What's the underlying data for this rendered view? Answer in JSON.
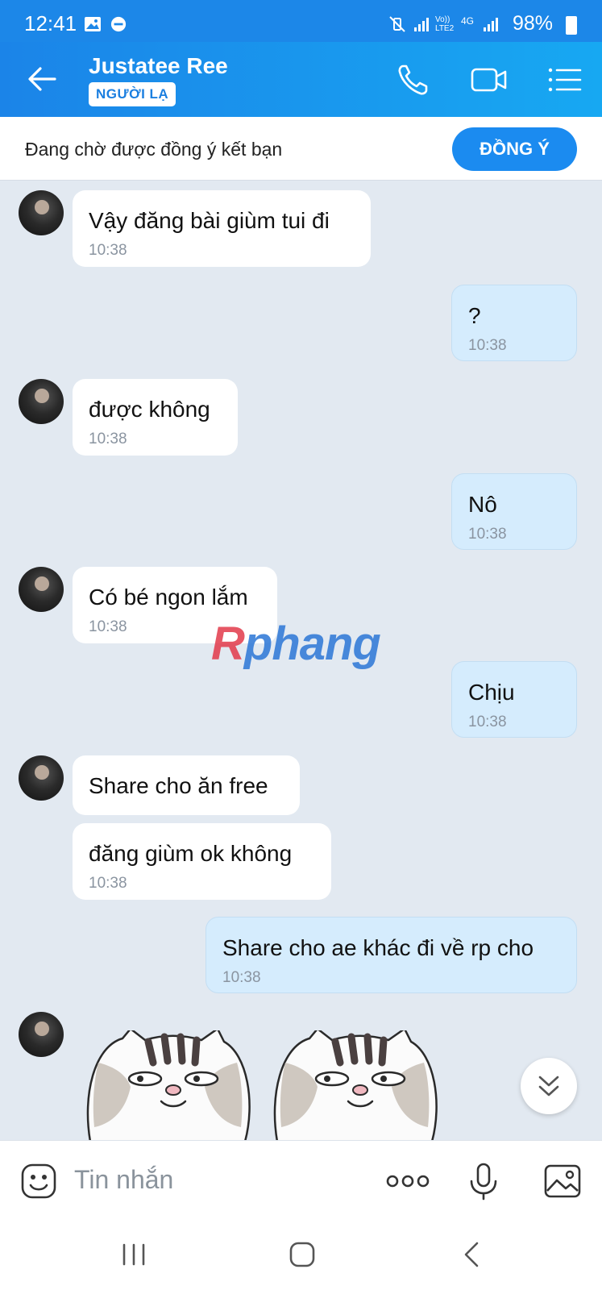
{
  "status_bar": {
    "time": "12:41",
    "network_label_1": "Vo)) LTE2",
    "network_label_2": "4G",
    "battery": "98%"
  },
  "header": {
    "contact_name": "Justatee Ree",
    "badge": "NGƯỜI LẠ",
    "icons": [
      "back-arrow-icon",
      "phone-icon",
      "video-call-icon",
      "menu-list-icon"
    ]
  },
  "friend_request": {
    "text": "Đang chờ được đồng ý kết bạn",
    "accept_label": "ĐỒNG Ý"
  },
  "messages": [
    {
      "side": "in",
      "text": "Vậy đăng bài giùm tui đi",
      "time": "10:38"
    },
    {
      "side": "out",
      "text": "?",
      "time": "10:38"
    },
    {
      "side": "in",
      "text": "được không",
      "time": "10:38"
    },
    {
      "side": "out",
      "text": "Nô",
      "time": "10:38"
    },
    {
      "side": "in",
      "text": "Có bé ngon lắm",
      "time": "10:38"
    },
    {
      "side": "out",
      "text": "Chịu",
      "time": "10:38"
    },
    {
      "side": "in",
      "text": "Share cho ăn free",
      "time": ""
    },
    {
      "side": "in",
      "text": "đăng giùm ok không",
      "time": "10:38"
    },
    {
      "side": "out",
      "text": "Share cho ae khác đi về rp cho",
      "time": "10:38"
    }
  ],
  "watermark": {
    "first": "R",
    "rest": "phang"
  },
  "composer": {
    "placeholder": "Tin nhắn",
    "icons": [
      "emoji-icon",
      "more-dots-icon",
      "microphone-icon",
      "image-icon"
    ]
  },
  "colors": {
    "header_start": "#1b84e8",
    "header_end": "#17a8f2",
    "accent": "#1b8bf0",
    "chat_bg": "#e2e9f1",
    "outgoing_bubble": "#d5ecfd"
  }
}
